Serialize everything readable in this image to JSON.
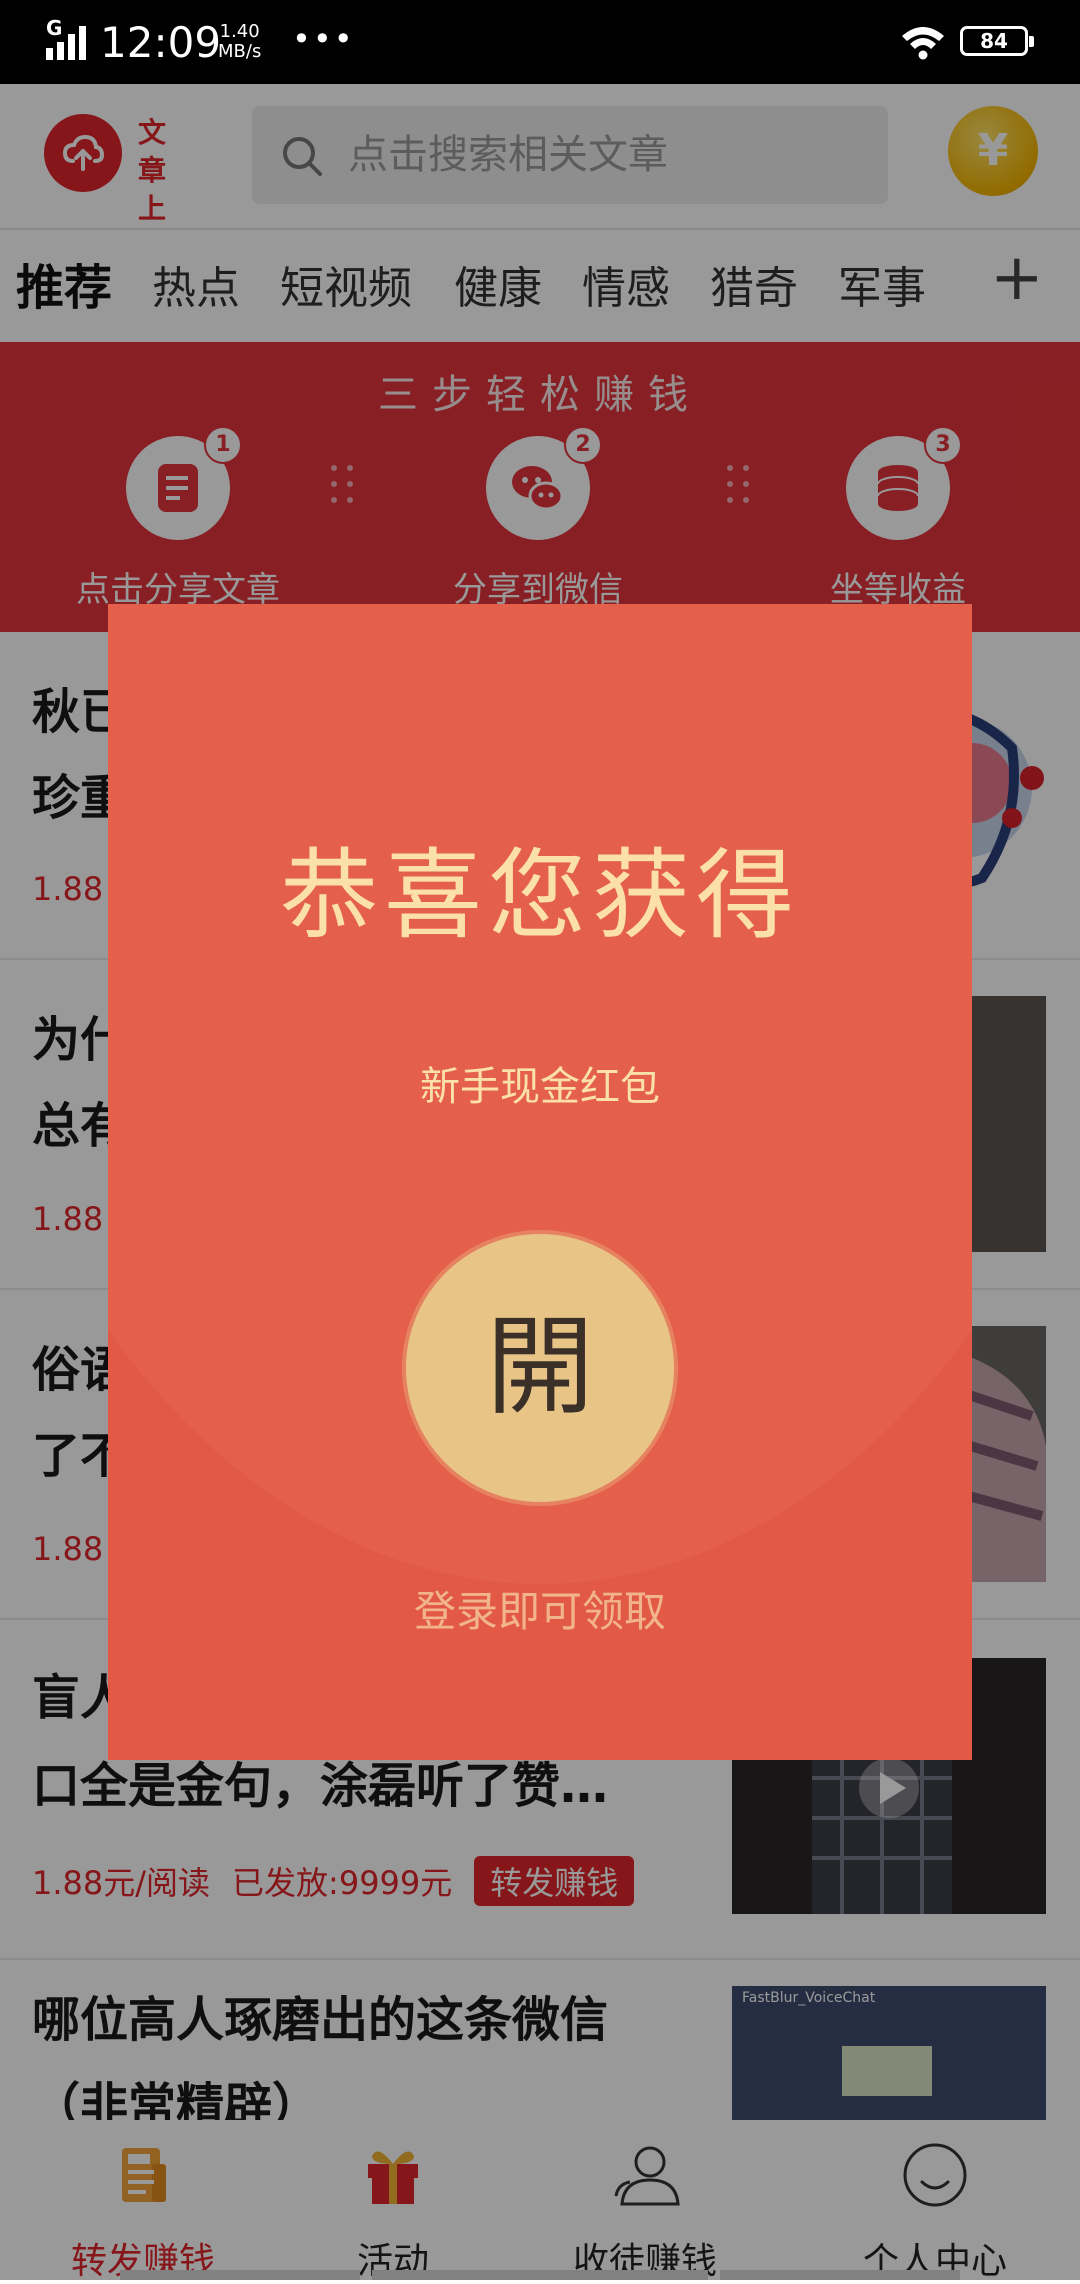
{
  "status_bar": {
    "network": "G",
    "time": "12:09",
    "speed_value": "1.40",
    "speed_unit": "MB/s",
    "more": "•••",
    "battery": "84"
  },
  "header": {
    "upload_label_line1": "文 章",
    "upload_label_line2": "上 传",
    "search_placeholder": "点击搜索相关文章",
    "coin_symbol": "¥"
  },
  "tabs": {
    "items": [
      "推荐",
      "热点",
      "短视频",
      "健康",
      "情感",
      "猎奇",
      "军事"
    ],
    "add": "+"
  },
  "banner": {
    "title": "三步轻松赚钱",
    "steps": [
      {
        "num": "1",
        "label": "点击分享文章"
      },
      {
        "num": "2",
        "label": "分享到微信"
      },
      {
        "num": "3",
        "label": "坐等收益"
      }
    ]
  },
  "articles": [
    {
      "title_l1": "秋已",
      "title_l2": "珍重",
      "price": "1.88",
      "published": "",
      "share": ""
    },
    {
      "title_l1": "为什",
      "title_l2": "总有",
      "price": "1.88",
      "published": "",
      "share": ""
    },
    {
      "title_l1": "俗语",
      "title_l2": "了不",
      "price": "1.88",
      "published": "",
      "share": ""
    },
    {
      "title_l1": "盲人",
      "title_l2": "口全是金句，涂磊听了赞…",
      "price": "1.88元/阅读",
      "published": "已发放:9999元",
      "share": "转发赚钱"
    },
    {
      "title_l1": "哪位高人琢磨出的这条微信",
      "title_l2": "（非常精辟）",
      "price": "",
      "published": "",
      "share": ""
    }
  ],
  "thumb_labels": {
    "fastblur": "FastBlur_VoiceChat"
  },
  "red_packet": {
    "title": "恭喜您获得",
    "subtitle": "新手现金红包",
    "open_label": "開",
    "footer": "登录即可领取"
  },
  "bottom_nav": [
    {
      "label": "转发赚钱",
      "icon": "newspaper-icon",
      "active": true
    },
    {
      "label": "活动",
      "icon": "gift-icon",
      "active": false
    },
    {
      "label": "收徒赚钱",
      "icon": "users-icon",
      "active": false
    },
    {
      "label": "个人中心",
      "icon": "smiley-icon",
      "active": false
    }
  ],
  "colors": {
    "brand_red": "#e0252b",
    "packet_red": "#e25a46",
    "packet_gold": "#e8c486"
  }
}
